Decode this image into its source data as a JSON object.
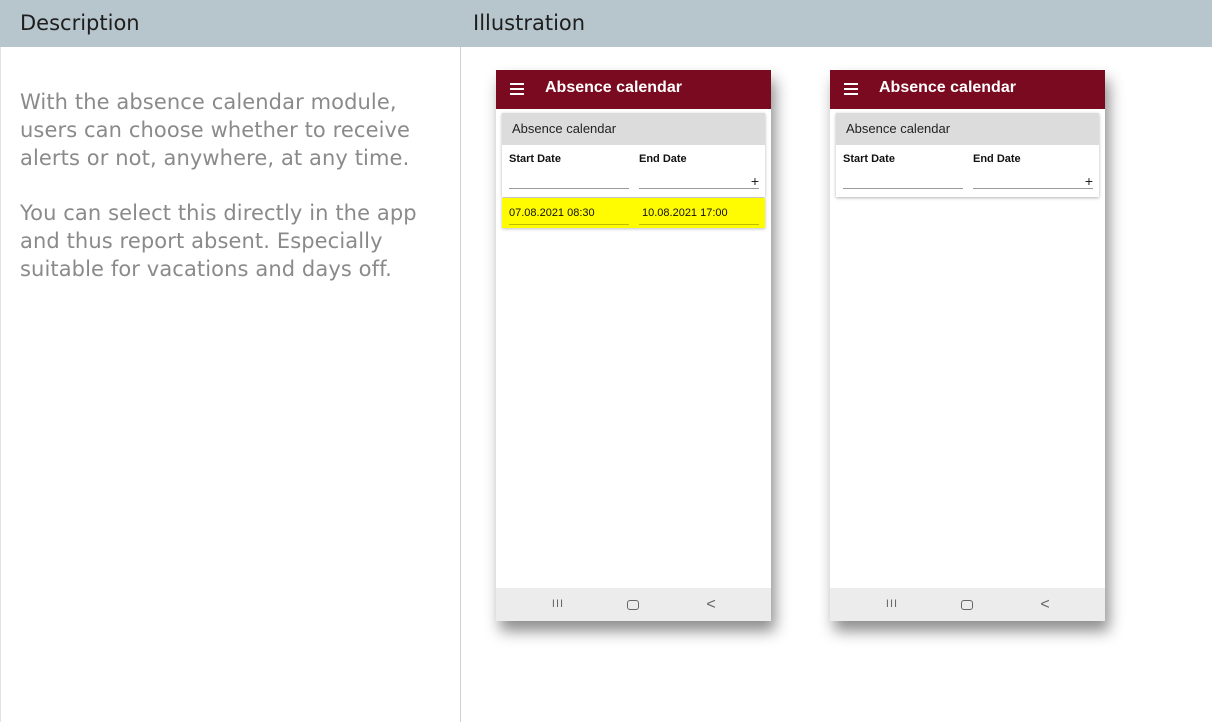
{
  "table": {
    "headers": {
      "description": "Description",
      "illustration": "Illustration"
    }
  },
  "description": {
    "paragraphs": [
      "With the absence calendar module, users can choose whether to receive alerts or not, anywhere, at any time.",
      "You can select this directly in the app and thus report absent. Especially suitable for vacations and days off."
    ]
  },
  "phones": [
    {
      "app_title": "Absence calendar",
      "card_title": "Absence calendar",
      "col_start": "Start Date",
      "col_end": "End Date",
      "add_label": "+",
      "entries": [
        {
          "start": "07.08.2021 08:30",
          "end": "10.08.2021 17:00"
        }
      ],
      "nav": {
        "recents": "III",
        "back": "<"
      }
    },
    {
      "app_title": "Absence calendar",
      "card_title": "Absence calendar",
      "col_start": "Start Date",
      "col_end": "End Date",
      "add_label": "+",
      "entries": [],
      "nav": {
        "recents": "III",
        "back": "<"
      }
    }
  ],
  "colors": {
    "header_bg": "#b7c5cc",
    "appbar": "#7a0a1f",
    "highlight": "#fffb00"
  },
  "icons": [
    "menu-icon",
    "add-icon",
    "recents-icon",
    "home-icon",
    "back-icon"
  ]
}
